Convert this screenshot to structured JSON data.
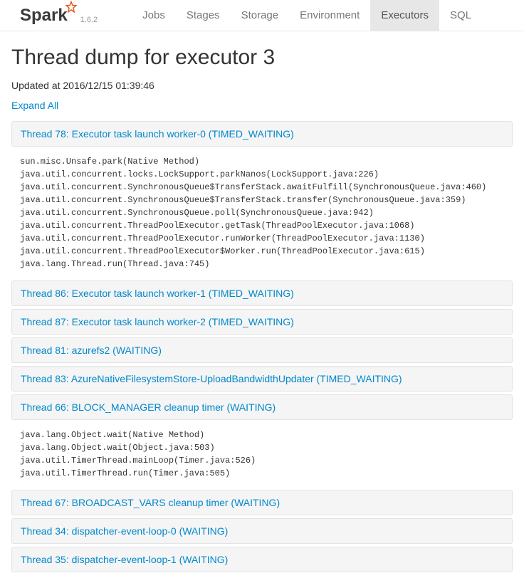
{
  "logo": {
    "text": "Spark",
    "version": "1.6.2"
  },
  "nav": {
    "tabs": [
      {
        "label": "Jobs",
        "active": false
      },
      {
        "label": "Stages",
        "active": false
      },
      {
        "label": "Storage",
        "active": false
      },
      {
        "label": "Environment",
        "active": false
      },
      {
        "label": "Executors",
        "active": true
      },
      {
        "label": "SQL",
        "active": false
      }
    ]
  },
  "page": {
    "title": "Thread dump for executor 3",
    "updated": "Updated at 2016/12/15 01:39:46",
    "expand_all": "Expand All"
  },
  "threads": [
    {
      "title": "Thread 78: Executor task launch worker-0 (TIMED_WAITING)",
      "expanded": true,
      "stack": "sun.misc.Unsafe.park(Native Method)\njava.util.concurrent.locks.LockSupport.parkNanos(LockSupport.java:226)\njava.util.concurrent.SynchronousQueue$TransferStack.awaitFulfill(SynchronousQueue.java:460)\njava.util.concurrent.SynchronousQueue$TransferStack.transfer(SynchronousQueue.java:359)\njava.util.concurrent.SynchronousQueue.poll(SynchronousQueue.java:942)\njava.util.concurrent.ThreadPoolExecutor.getTask(ThreadPoolExecutor.java:1068)\njava.util.concurrent.ThreadPoolExecutor.runWorker(ThreadPoolExecutor.java:1130)\njava.util.concurrent.ThreadPoolExecutor$Worker.run(ThreadPoolExecutor.java:615)\njava.lang.Thread.run(Thread.java:745)"
    },
    {
      "title": "Thread 86: Executor task launch worker-1 (TIMED_WAITING)",
      "expanded": false
    },
    {
      "title": "Thread 87: Executor task launch worker-2 (TIMED_WAITING)",
      "expanded": false
    },
    {
      "title": "Thread 81: azurefs2 (WAITING)",
      "expanded": false
    },
    {
      "title": "Thread 83: AzureNativeFilesystemStore-UploadBandwidthUpdater (TIMED_WAITING)",
      "expanded": false
    },
    {
      "title": "Thread 66: BLOCK_MANAGER cleanup timer (WAITING)",
      "expanded": true,
      "stack": "java.lang.Object.wait(Native Method)\njava.lang.Object.wait(Object.java:503)\njava.util.TimerThread.mainLoop(Timer.java:526)\njava.util.TimerThread.run(Timer.java:505)"
    },
    {
      "title": "Thread 67: BROADCAST_VARS cleanup timer (WAITING)",
      "expanded": false
    },
    {
      "title": "Thread 34: dispatcher-event-loop-0 (WAITING)",
      "expanded": false
    },
    {
      "title": "Thread 35: dispatcher-event-loop-1 (WAITING)",
      "expanded": false
    }
  ]
}
